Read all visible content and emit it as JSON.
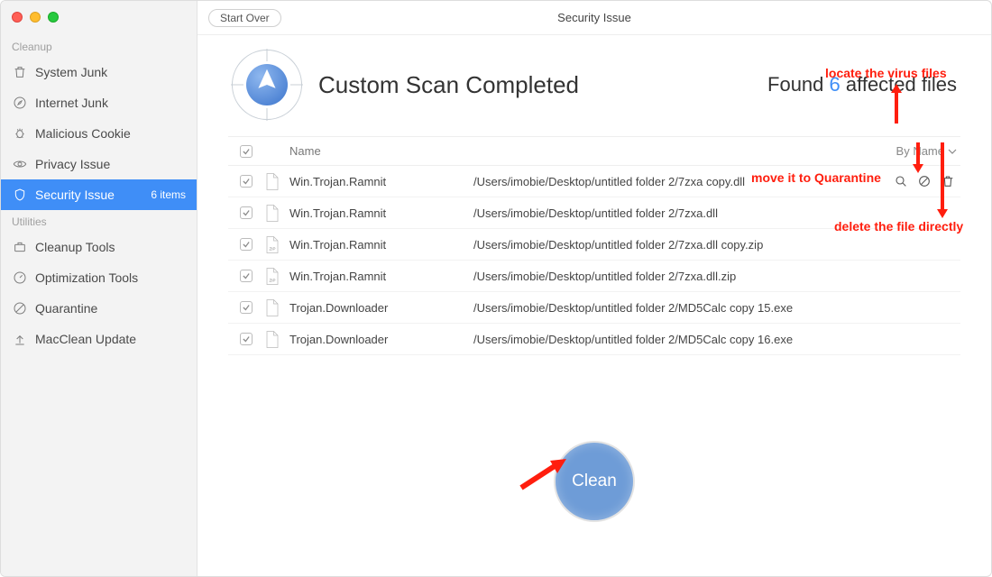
{
  "window": {
    "title": "Security Issue"
  },
  "toolbar": {
    "start_over": "Start Over"
  },
  "sidebar": {
    "groups": [
      {
        "label": "Cleanup",
        "items": [
          {
            "icon": "trash-icon",
            "label": "System Junk",
            "active": false
          },
          {
            "icon": "safari-icon",
            "label": "Internet Junk",
            "active": false
          },
          {
            "icon": "bug-icon",
            "label": "Malicious Cookie",
            "active": false
          },
          {
            "icon": "eye-icon",
            "label": "Privacy Issue",
            "active": false
          },
          {
            "icon": "shield-icon",
            "label": "Security Issue",
            "active": true,
            "count": "6 items"
          }
        ]
      },
      {
        "label": "Utilities",
        "items": [
          {
            "icon": "briefcase-icon",
            "label": "Cleanup Tools"
          },
          {
            "icon": "gauge-icon",
            "label": "Optimization Tools"
          },
          {
            "icon": "quarantine-icon",
            "label": "Quarantine"
          },
          {
            "icon": "upload-icon",
            "label": "MacClean Update"
          }
        ]
      }
    ]
  },
  "scan": {
    "title": "Custom Scan Completed",
    "found_prefix": "Found ",
    "found_count": "6",
    "found_suffix": " affected files"
  },
  "table": {
    "header_name": "Name",
    "sort_label": "By Name",
    "rows": [
      {
        "name": "Win.Trojan.Ramnit",
        "path": "/Users/imobie/Desktop/untitled folder 2/7zxa copy.dll",
        "type": "file",
        "show_actions": true
      },
      {
        "name": "Win.Trojan.Ramnit",
        "path": "/Users/imobie/Desktop/untitled folder 2/7zxa.dll",
        "type": "file"
      },
      {
        "name": "Win.Trojan.Ramnit",
        "path": "/Users/imobie/Desktop/untitled folder 2/7zxa.dll copy.zip",
        "type": "zip"
      },
      {
        "name": "Win.Trojan.Ramnit",
        "path": "/Users/imobie/Desktop/untitled folder 2/7zxa.dll.zip",
        "type": "zip"
      },
      {
        "name": "Trojan.Downloader",
        "path": "/Users/imobie/Desktop/untitled folder 2/MD5Calc copy 15.exe",
        "type": "file"
      },
      {
        "name": "Trojan.Downloader",
        "path": "/Users/imobie/Desktop/untitled folder 2/MD5Calc copy 16.exe",
        "type": "file"
      }
    ]
  },
  "clean_label": "Clean",
  "annotations": {
    "locate": "locate the virus files",
    "quarantine": "move it to Quarantine",
    "delete": "delete the file directly"
  }
}
